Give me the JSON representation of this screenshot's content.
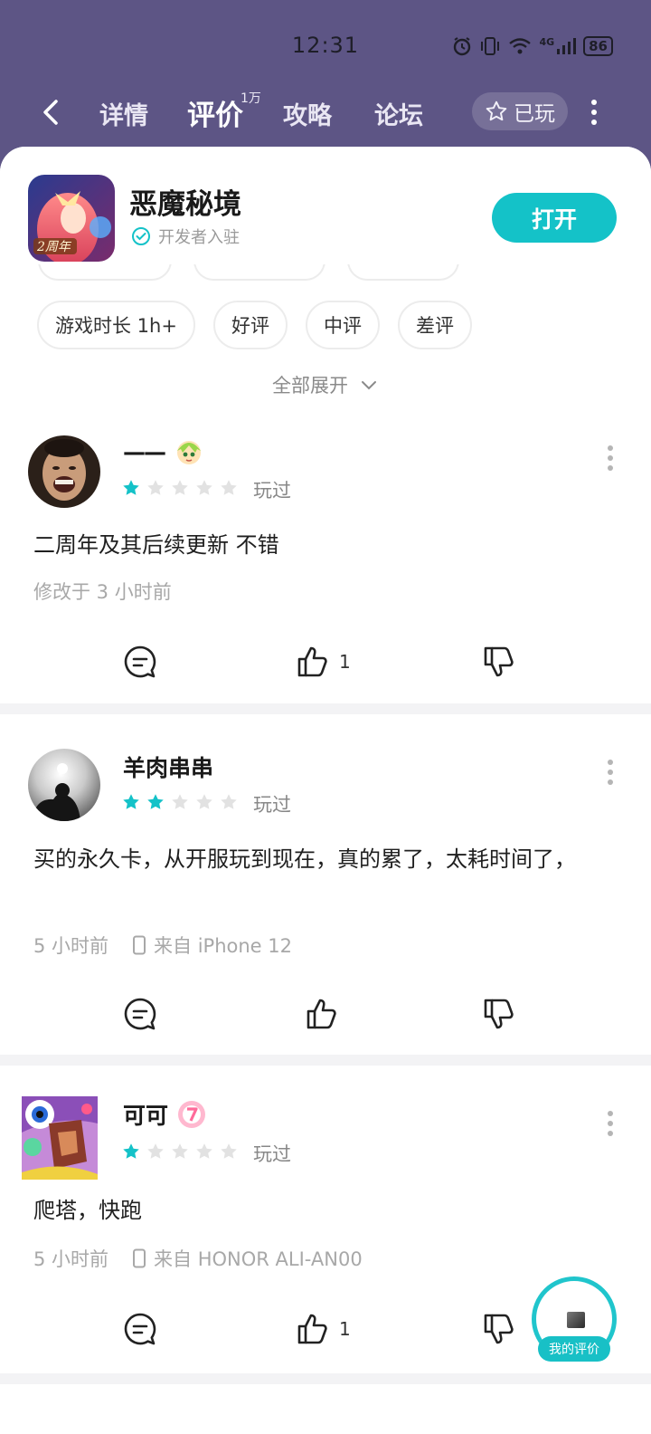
{
  "status": {
    "time": "12:31",
    "battery": "86",
    "network": "4G"
  },
  "nav": {
    "tabs": [
      {
        "label": "详情"
      },
      {
        "label": "评价",
        "badge": "1万"
      },
      {
        "label": "攻略"
      },
      {
        "label": "论坛"
      }
    ],
    "played_label": "已玩"
  },
  "game": {
    "title": "恶魔秘境",
    "dev_label": "开发者入驻",
    "open_label": "打开"
  },
  "filters": [
    "游戏时长 1h+",
    "好评",
    "中评",
    "差评"
  ],
  "expand_label": "全部展开",
  "colors": {
    "accent": "#14c2c8",
    "header_bg": "#5d5585",
    "star_on": "#14c2c8",
    "star_off": "#e2e2e2"
  },
  "reviews": [
    {
      "username": "——",
      "rating": 1,
      "played": "玩过",
      "body": "二周年及其后续更新 不错",
      "time": "修改于 3 小时前",
      "device": "",
      "likes": "1"
    },
    {
      "username": "羊肉串串",
      "rating": 2,
      "played": "玩过",
      "body": "买的永久卡，从开服玩到现在，真的累了，太耗时间了，",
      "time": "5 小时前",
      "device": "来自 iPhone 12",
      "likes": ""
    },
    {
      "username": "可可",
      "rating": 1,
      "played": "玩过",
      "body": "爬塔，快跑",
      "time": "5 小时前",
      "device": "来自 HONOR ALI-AN00",
      "likes": "1"
    }
  ],
  "fab_label": "我的评价"
}
